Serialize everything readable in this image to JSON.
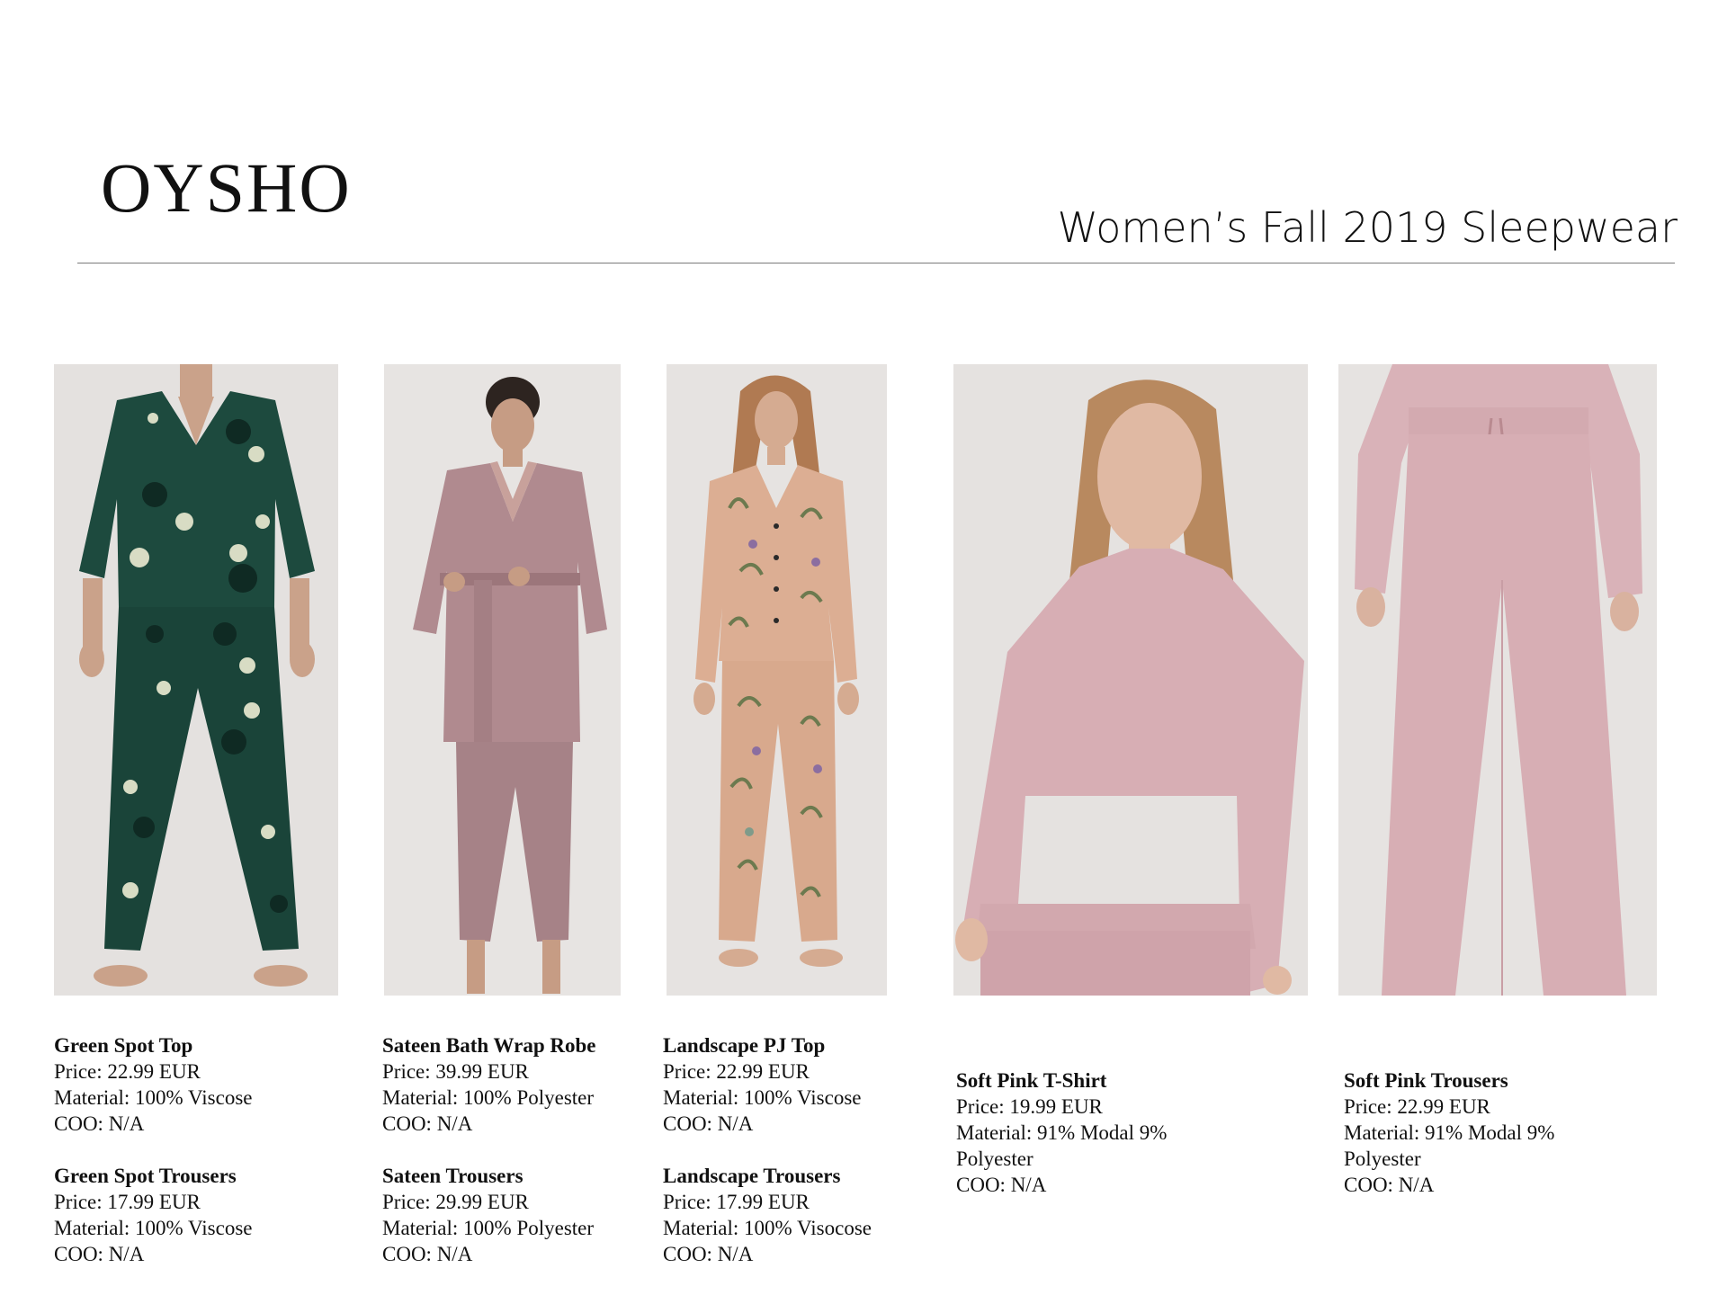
{
  "header": {
    "brand_logo": "OYSHO",
    "title": "Women’s Fall 2019 Sleepwear"
  },
  "colors": {
    "background": "#ffffff",
    "photo_backdrop": "#e6e3e1",
    "green_pyjama": "#1d4a3e",
    "mauve_satin": "#b48f93",
    "floral_peach": "#dcae93",
    "soft_pink": "#d7aeb4"
  },
  "products": [
    {
      "photo": "green spot pyjama",
      "items": [
        {
          "name": "Green Spot Top",
          "price": "Price: 22.99 EUR",
          "material": "Material: 100% Viscose",
          "coo": "COO: N/A"
        },
        {
          "name": "Green Spot Trousers",
          "price": "Price: 17.99 EUR",
          "material": "Material: 100% Viscose",
          "coo": "COO: N/A"
        }
      ]
    },
    {
      "photo": "sateen robe and trousers",
      "items": [
        {
          "name": "Sateen Bath Wrap Robe",
          "price": "Price: 39.99 EUR",
          "material": "Material: 100% Polyester",
          "coo": "COO: N/A"
        },
        {
          "name": "Sateen Trousers",
          "price": "Price: 29.99 EUR",
          "material": "Material: 100% Polyester",
          "coo": "COO: N/A"
        }
      ]
    },
    {
      "photo": "landscape print pyjama",
      "items": [
        {
          "name": "Landscape PJ Top",
          "price": "Price: 22.99 EUR",
          "material": "Material: 100% Viscose",
          "coo": "COO: N/A"
        },
        {
          "name": "Landscape Trousers",
          "price": "Price: 17.99 EUR",
          "material": "Material: 100% Visocose",
          "coo": "COO: N/A"
        }
      ]
    },
    {
      "photo": "soft pink t-shirt",
      "items": [
        {
          "name": "Soft Pink T-Shirt",
          "price": "Price: 19.99 EUR",
          "material_line1": "Material: 91% Modal 9%",
          "material_line2": "Polyester",
          "coo": "COO: N/A"
        }
      ]
    },
    {
      "photo": "soft pink trousers",
      "items": [
        {
          "name": "Soft Pink Trousers",
          "price": "Price: 22.99 EUR",
          "material_line1": "Material: 91% Modal 9%",
          "material_line2": "Polyester",
          "coo": "COO: N/A"
        }
      ]
    }
  ]
}
